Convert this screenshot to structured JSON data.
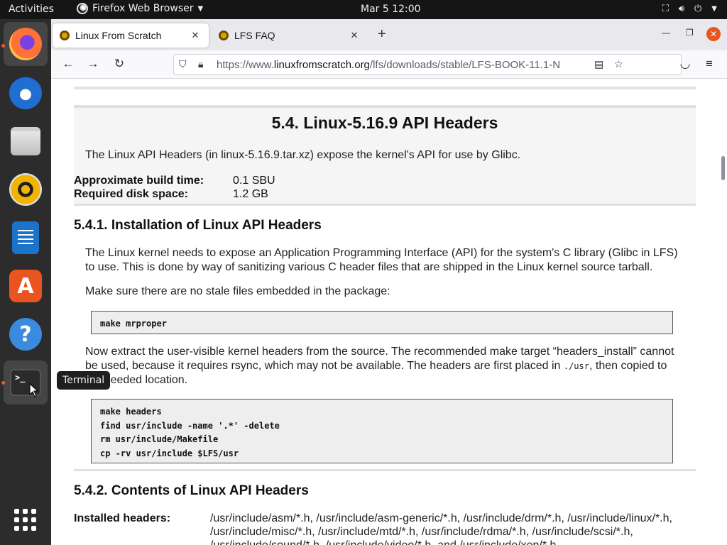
{
  "topbar": {
    "activities": "Activities",
    "app_name": "Firefox Web Browser",
    "clock": "Mar 5  12:00"
  },
  "dock": {
    "items": [
      "Firefox",
      "Thunderbird Mail",
      "Files",
      "Rhythmbox",
      "LibreOffice Writer",
      "Ubuntu Software",
      "Help",
      "Terminal"
    ],
    "tooltip": "Terminal"
  },
  "tabs": [
    {
      "title": "Linux From Scratch",
      "active": true
    },
    {
      "title": "LFS FAQ",
      "active": false
    }
  ],
  "navbar": {
    "url_prefix": "https://www.",
    "url_domain": "linuxfromscratch.org",
    "url_path": "/lfs/downloads/stable/LFS-BOOK-11.1-N"
  },
  "page": {
    "title": "5.4. Linux-5.16.9 API Headers",
    "intro": "The Linux API Headers (in linux-5.16.9.tar.xz) expose the kernel's API for use by Glibc.",
    "build_time_label": "Approximate build time:",
    "build_time_value": "0.1 SBU",
    "disk_space_label": "Required disk space:",
    "disk_space_value": "1.2 GB",
    "section1_title": "5.4.1. Installation of Linux API Headers",
    "section1_para1": "The Linux kernel needs to expose an Application Programming Interface (API) for the system's C library (Glibc in LFS) to use. This is done by way of sanitizing various C header files that are shipped in the Linux kernel source tarball.",
    "section1_para2": "Make sure there are no stale files embedded in the package:",
    "code1": [
      "make mrproper"
    ],
    "section1_para3_a": "Now extract the user-visible kernel headers from the source. The recommended make target “headers_install” cannot be used, because it requires rsync, which may not be available. The headers are first placed in ",
    "section1_para3_code": "./usr",
    "section1_para3_b": ", then copied to the needed location.",
    "code2": [
      "make headers",
      "find usr/include -name '.*' -delete",
      "rm usr/include/Makefile",
      "cp -rv usr/include $LFS/usr"
    ],
    "section2_title": "5.4.2. Contents of Linux API Headers",
    "installed_headers_label": "Installed headers:",
    "installed_headers_value": "/usr/include/asm/*.h, /usr/include/asm-generic/*.h, /usr/include/drm/*.h, /usr/include/linux/*.h, /usr/include/misc/*.h, /usr/include/mtd/*.h, /usr/include/rdma/*.h, /usr/include/scsi/*.h, /usr/include/sound/*.h, /usr/include/video/*.h, and /usr/include/xen/*.h"
  }
}
